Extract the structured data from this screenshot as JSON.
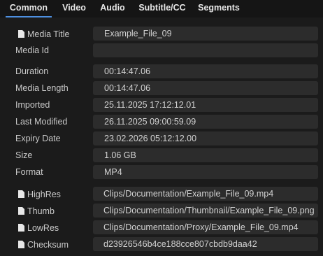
{
  "tabs": [
    "Common",
    "Video",
    "Audio",
    "Subtitle/CC",
    "Segments"
  ],
  "active_tab": "Common",
  "accent_color": "#4d8fe0",
  "fields": [
    {
      "label": "Media Title",
      "value": "Example_File_09",
      "icon": "document-icon"
    },
    {
      "label": "Media Id",
      "value": ""
    },
    {
      "label": "Duration",
      "value": "00:14:47.06"
    },
    {
      "label": "Media Length",
      "value": "00:14:47.06"
    },
    {
      "label": "Imported",
      "value": "25.11.2025 17:12:12.01"
    },
    {
      "label": "Last Modified",
      "value": "26.11.2025 09:00:59.09"
    },
    {
      "label": "Expiry Date",
      "value": "23.02.2026 05:12:12.00"
    },
    {
      "label": "Size",
      "value": "1.06 GB"
    },
    {
      "label": "Format",
      "value": "MP4"
    },
    {
      "label": "HighRes",
      "value": "Clips/Documentation/Example_File_09.mp4",
      "icon": "document-icon"
    },
    {
      "label": "Thumb",
      "value": "Clips/Documentation/Thumbnail/Example_File_09.png",
      "icon": "document-icon"
    },
    {
      "label": "LowRes",
      "value": "Clips/Documentation/Proxy/Example_File_09.mp4",
      "icon": "document-icon"
    },
    {
      "label": "Checksum",
      "value": "d23926546b4ce188cce807cbdb9daa42",
      "icon": "document-icon"
    }
  ]
}
